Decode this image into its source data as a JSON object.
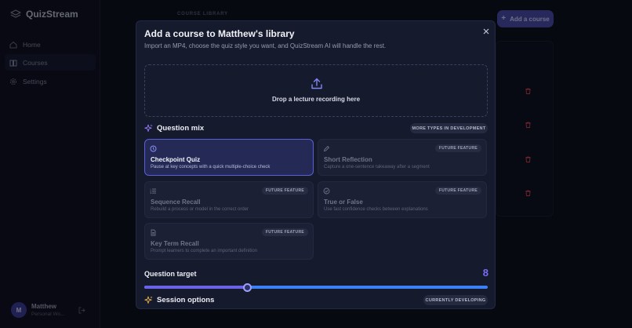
{
  "app": {
    "name": "QuizStream"
  },
  "sidebar": {
    "items": [
      {
        "label": "Home",
        "icon": "home-icon",
        "active": false
      },
      {
        "label": "Courses",
        "icon": "book-icon",
        "active": true
      },
      {
        "label": "Settings",
        "icon": "gear-icon",
        "active": false
      }
    ],
    "user": {
      "initial": "M",
      "name": "Matthew",
      "plan": "Personal Wo..."
    }
  },
  "main": {
    "section_label": "COURSE LIBRARY",
    "add_button": "Add a course"
  },
  "modal": {
    "title": "Add a course to Matthew's library",
    "subtitle": "Import an MP4, choose the quiz style you want, and QuizStream AI will handle the rest.",
    "dropzone": {
      "text": "Drop a lecture recording here"
    },
    "question_mix": {
      "title": "Question mix",
      "badge": "MORE TYPES IN DEVELOPMENT",
      "cards": [
        {
          "title": "Checkpoint Quiz",
          "description": "Pause at key concepts with a quick multiple-choice check",
          "badge": "",
          "icon": "clock-icon",
          "selected": true
        },
        {
          "title": "Short Reflection",
          "description": "Capture a one-sentence takeaway after a segment",
          "badge": "FUTURE FEATURE",
          "icon": "pencil-icon",
          "selected": false
        },
        {
          "title": "Sequence Recall",
          "description": "Rebuild a process or model in the correct order",
          "badge": "FUTURE FEATURE",
          "icon": "ordered-list-icon",
          "selected": false
        },
        {
          "title": "True or False",
          "description": "Use fast confidence checks between explanations",
          "badge": "FUTURE FEATURE",
          "icon": "check-circle-icon",
          "selected": false
        },
        {
          "title": "Key Term Recall",
          "description": "Prompt learners to complete an important definition",
          "badge": "FUTURE FEATURE",
          "icon": "document-icon",
          "selected": false
        }
      ]
    },
    "question_target": {
      "label": "Question target",
      "value": "8",
      "fraction": 0.3
    },
    "session_options": {
      "title": "Session options",
      "badge": "CURRENTLY DEVELOPING"
    }
  },
  "colors": {
    "accent": "#6b63e6",
    "slider_track": "#3b82f6",
    "delete": "#e0414f"
  }
}
